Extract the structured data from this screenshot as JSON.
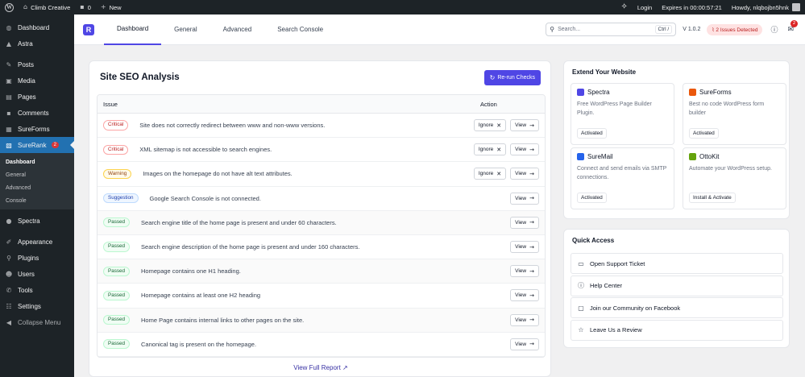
{
  "admin_bar": {
    "site_name": "Climb Creative",
    "comments_count": "0",
    "new_label": "New",
    "login_label": "Login",
    "expires_label": "Expires in 00:00:57:21",
    "howdy_label": "Howdy, nlqbojbn5hnk"
  },
  "sidebar": {
    "items_top": [
      {
        "label": "Dashboard",
        "icon": "dashboard-icon"
      },
      {
        "label": "Astra",
        "icon": "astra-icon"
      }
    ],
    "items_mid": [
      {
        "label": "Posts",
        "icon": "pin-icon"
      },
      {
        "label": "Media",
        "icon": "media-icon"
      },
      {
        "label": "Pages",
        "icon": "pages-icon"
      },
      {
        "label": "Comments",
        "icon": "comments-icon"
      },
      {
        "label": "SureForms",
        "icon": "sureforms-icon"
      }
    ],
    "active": {
      "label": "SureRank",
      "badge": "2"
    },
    "submenu": [
      "Dashboard",
      "General",
      "Advanced",
      "Console"
    ],
    "spectra": "Spectra",
    "items_bottom": [
      {
        "label": "Appearance"
      },
      {
        "label": "Plugins"
      },
      {
        "label": "Users"
      },
      {
        "label": "Tools"
      },
      {
        "label": "Settings"
      },
      {
        "label": "Collapse Menu"
      }
    ]
  },
  "header": {
    "tabs": [
      "Dashboard",
      "General",
      "Advanced",
      "Search Console"
    ],
    "search_placeholder": "Search...",
    "search_shortcut": "Ctrl /",
    "version": "V 1.0.2",
    "issues_badge": "2 Issues Detected",
    "notifications_count": "2"
  },
  "seo": {
    "title": "Site SEO Analysis",
    "rerun_label": "Re-run Checks",
    "col_issue": "Issue",
    "col_action": "Action",
    "ignore_label": "Ignore",
    "view_label": "View",
    "rows": [
      {
        "status": "Critical",
        "kind": "critical",
        "text": "Site does not correctly redirect between www and non-www versions.",
        "ignore": true
      },
      {
        "status": "Critical",
        "kind": "critical",
        "text": "XML sitemap is not accessible to search engines.",
        "ignore": true
      },
      {
        "status": "Warning",
        "kind": "warning",
        "text": "Images on the homepage do not have alt text attributes.",
        "ignore": true
      },
      {
        "status": "Suggestion",
        "kind": "suggestion",
        "text": "Google Search Console is not connected.",
        "ignore": false
      },
      {
        "status": "Passed",
        "kind": "passed",
        "text": "Search engine title of the home page is present and under 60 characters.",
        "ignore": false
      },
      {
        "status": "Passed",
        "kind": "passed",
        "text": "Search engine description of the home page is present and under 160 characters.",
        "ignore": false
      },
      {
        "status": "Passed",
        "kind": "passed",
        "text": "Homepage contains one H1 heading.",
        "ignore": false
      },
      {
        "status": "Passed",
        "kind": "passed",
        "text": "Homepage contains at least one H2 heading",
        "ignore": false
      },
      {
        "status": "Passed",
        "kind": "passed",
        "text": "Home Page contains internal links to other pages on the site.",
        "ignore": false
      },
      {
        "status": "Passed",
        "kind": "passed",
        "text": "Canonical tag is present on the homepage.",
        "ignore": false
      }
    ],
    "full_report_label": "View Full Report"
  },
  "extend": {
    "title": "Extend Your Website",
    "plugins": [
      {
        "name": "Spectra",
        "desc": "Free WordPress Page Builder Plugin.",
        "button": "Activated",
        "color": "#4f46e5"
      },
      {
        "name": "SureForms",
        "desc": "Best no code WordPress form builder",
        "button": "Activated",
        "color": "#ea580c"
      },
      {
        "name": "SureMail",
        "desc": "Connect and send emails via SMTP connections.",
        "button": "Activated",
        "color": "#2563eb"
      },
      {
        "name": "OttoKit",
        "desc": "Automate your WordPress setup.",
        "button": "Install & Activate",
        "color": "#65a30d"
      }
    ]
  },
  "quick": {
    "title": "Quick Access",
    "items": [
      {
        "label": "Open Support Ticket",
        "icon": "ticket-icon"
      },
      {
        "label": "Help Center",
        "icon": "help-icon"
      },
      {
        "label": "Join our Community on Facebook",
        "icon": "chat-icon"
      },
      {
        "label": "Leave Us a Review",
        "icon": "star-icon"
      }
    ]
  }
}
